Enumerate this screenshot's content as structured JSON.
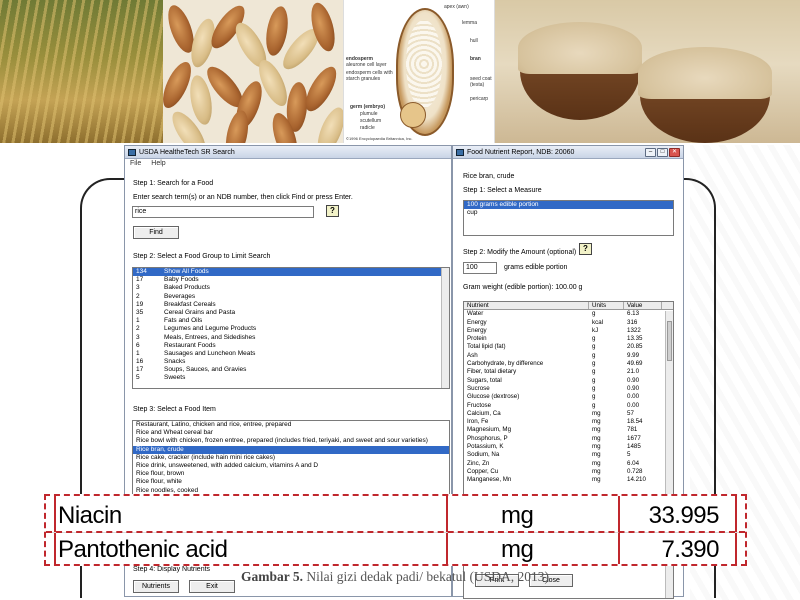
{
  "images": {
    "diagram_labels": {
      "apex": "apex (awn)",
      "lemma": "lemma",
      "hull": "hull",
      "endosperm": "endosperm",
      "aleurone": "aleurone cell layer",
      "starch": "endosperm cells with starch granules",
      "bran": "bran",
      "seed_coat": "seed coat (testa)",
      "pericarp": "pericarp",
      "germ": "germ (embryo)",
      "plumule": "plumule",
      "scutellum": "scutellum",
      "radicle": "radicle",
      "copyright": "©1996 Encyclopaedia Britannica, Inc."
    }
  },
  "search_window": {
    "title": "USDA HealtheTech SR Search",
    "menu": [
      "File",
      "Help"
    ],
    "step1": "Step 1: Search for a Food",
    "instruction": "Enter search term(s) or an NDB number, then click Find or press Enter.",
    "search_value": "rice",
    "help": "?",
    "find_label": "Find",
    "step2": "Step 2: Select a Food Group to Limit Search",
    "food_groups": [
      {
        "code": "134",
        "name": "Show All Foods"
      },
      {
        "code": "17",
        "name": "Baby Foods"
      },
      {
        "code": "3",
        "name": "Baked Products"
      },
      {
        "code": "2",
        "name": "Beverages"
      },
      {
        "code": "19",
        "name": "Breakfast Cereals"
      },
      {
        "code": "35",
        "name": "Cereal Grains and Pasta"
      },
      {
        "code": "1",
        "name": "Fats and Oils"
      },
      {
        "code": "2",
        "name": "Legumes and Legume Products"
      },
      {
        "code": "3",
        "name": "Meals, Entrees, and Sidedishes"
      },
      {
        "code": "6",
        "name": "Restaurant Foods"
      },
      {
        "code": "1",
        "name": "Sausages and Luncheon Meats"
      },
      {
        "code": "16",
        "name": "Snacks"
      },
      {
        "code": "17",
        "name": "Soups, Sauces, and Gravies"
      },
      {
        "code": "5",
        "name": "Sweets"
      }
    ],
    "step3": "Step 3: Select a Food Item",
    "food_items": [
      "Restaurant, Latino, chicken and rice, entree, prepared",
      "Rice and Wheat cereal bar",
      "Rice bowl with chicken, frozen entree, prepared (includes fried, teriyaki, and sweet and sour varieties)",
      "Rice bran, crude",
      "Rice cake, cracker (include hain mini rice cakes)",
      "Rice drink, unsweetened, with added calcium, vitamins A and D",
      "Rice flour, brown",
      "Rice flour, white",
      "Rice noodles, cooked"
    ],
    "step4": "Step 4: Display Nutrients",
    "nutrients_label": "Nutrients",
    "exit_label": "Exit"
  },
  "report_window": {
    "title": "Food Nutrient Report, NDB: 20060",
    "food_name": "Rice bran, crude",
    "step1": "Step 1: Select a Measure",
    "measures": [
      "100 grams edible portion",
      "cup"
    ],
    "step2": "Step 2: Modify the Amount (optional)",
    "amount_value": "100",
    "amount_unit": "grams edible portion",
    "gram_weight": "Gram weight (edible portion): 100.00 g",
    "table_headers": [
      "Nutrient",
      "Units",
      "Value"
    ],
    "nutrients": [
      [
        "Water",
        "g",
        "6.13"
      ],
      [
        "Energy",
        "kcal",
        "316"
      ],
      [
        "Energy",
        "kJ",
        "1322"
      ],
      [
        "Protein",
        "g",
        "13.35"
      ],
      [
        "Total lipid (fat)",
        "g",
        "20.85"
      ],
      [
        "Ash",
        "g",
        "9.99"
      ],
      [
        "Carbohydrate, by difference",
        "g",
        "49.69"
      ],
      [
        "Fiber, total dietary",
        "g",
        "21.0"
      ],
      [
        "Sugars, total",
        "g",
        "0.90"
      ],
      [
        "Sucrose",
        "g",
        "0.90"
      ],
      [
        "Glucose (dextrose)",
        "g",
        "0.00"
      ],
      [
        "Fructose",
        "g",
        "0.00"
      ],
      [
        "Calcium, Ca",
        "mg",
        "57"
      ],
      [
        "Iron, Fe",
        "mg",
        "18.54"
      ],
      [
        "Magnesium, Mg",
        "mg",
        "781"
      ],
      [
        "Phosphorus, P",
        "mg",
        "1677"
      ],
      [
        "Potassium, K",
        "mg",
        "1485"
      ],
      [
        "Sodium, Na",
        "mg",
        "5"
      ],
      [
        "Zinc, Zn",
        "mg",
        "6.04"
      ],
      [
        "Copper, Cu",
        "mg",
        "0.728"
      ],
      [
        "Manganese, Mn",
        "mg",
        "14.210"
      ]
    ],
    "print_label": "Print",
    "close_label": "Close"
  },
  "callout": {
    "rows": [
      {
        "nutrient": "Niacin",
        "unit": "mg",
        "value": "33.995"
      },
      {
        "nutrient": "Pantothenic acid",
        "unit": "mg",
        "value": "7.390"
      }
    ],
    "border_color": "#c0272d"
  },
  "caption": {
    "label": "Gambar 5.",
    "text": "Nilai gizi dedak padi/ bekatul (USDA, 2013)"
  }
}
